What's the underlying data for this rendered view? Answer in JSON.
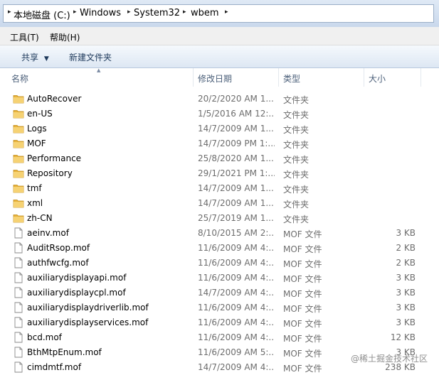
{
  "breadcrumb": [
    {
      "label": "本地磁盘 (C:)"
    },
    {
      "label": "Windows"
    },
    {
      "label": "System32"
    },
    {
      "label": "wbem"
    }
  ],
  "menu": {
    "tools": "工具(T)",
    "help": "帮助(H)"
  },
  "toolbar": {
    "share": "共享",
    "new_folder": "新建文件夹"
  },
  "columns": {
    "name": "名称",
    "date": "修改日期",
    "type": "类型",
    "size": "大小"
  },
  "files": [
    {
      "name": "AutoRecover",
      "date": "20/2/2020 AM 1...",
      "type": "文件夹",
      "size": "",
      "icon": "folder-icon"
    },
    {
      "name": "en-US",
      "date": "1/5/2016 AM 12:...",
      "type": "文件夹",
      "size": "",
      "icon": "folder-icon"
    },
    {
      "name": "Logs",
      "date": "14/7/2009 AM 1...",
      "type": "文件夹",
      "size": "",
      "icon": "folder-icon"
    },
    {
      "name": "MOF",
      "date": "14/7/2009 PM 1:...",
      "type": "文件夹",
      "size": "",
      "icon": "folder-icon"
    },
    {
      "name": "Performance",
      "date": "25/8/2020 AM 1...",
      "type": "文件夹",
      "size": "",
      "icon": "folder-icon"
    },
    {
      "name": "Repository",
      "date": "29/1/2021 PM 1:...",
      "type": "文件夹",
      "size": "",
      "icon": "folder-icon"
    },
    {
      "name": "tmf",
      "date": "14/7/2009 AM 1...",
      "type": "文件夹",
      "size": "",
      "icon": "folder-icon"
    },
    {
      "name": "xml",
      "date": "14/7/2009 AM 1...",
      "type": "文件夹",
      "size": "",
      "icon": "folder-icon"
    },
    {
      "name": "zh-CN",
      "date": "25/7/2019 AM 1...",
      "type": "文件夹",
      "size": "",
      "icon": "folder-icon"
    },
    {
      "name": "aeinv.mof",
      "date": "8/10/2015 AM 2:...",
      "type": "MOF 文件",
      "size": "3 KB",
      "icon": "file-icon"
    },
    {
      "name": "AuditRsop.mof",
      "date": "11/6/2009 AM 4:...",
      "type": "MOF 文件",
      "size": "2 KB",
      "icon": "file-icon"
    },
    {
      "name": "authfwcfg.mof",
      "date": "11/6/2009 AM 4:...",
      "type": "MOF 文件",
      "size": "2 KB",
      "icon": "file-icon"
    },
    {
      "name": "auxiliarydisplayapi.mof",
      "date": "11/6/2009 AM 4:...",
      "type": "MOF 文件",
      "size": "3 KB",
      "icon": "file-icon"
    },
    {
      "name": "auxiliarydisplaycpl.mof",
      "date": "14/7/2009 AM 4:...",
      "type": "MOF 文件",
      "size": "3 KB",
      "icon": "file-icon"
    },
    {
      "name": "auxiliarydisplaydriverlib.mof",
      "date": "11/6/2009 AM 4:...",
      "type": "MOF 文件",
      "size": "3 KB",
      "icon": "file-icon"
    },
    {
      "name": "auxiliarydisplayservices.mof",
      "date": "11/6/2009 AM 4:...",
      "type": "MOF 文件",
      "size": "3 KB",
      "icon": "file-icon"
    },
    {
      "name": "bcd.mof",
      "date": "11/6/2009 AM 4:...",
      "type": "MOF 文件",
      "size": "12 KB",
      "icon": "file-icon"
    },
    {
      "name": "BthMtpEnum.mof",
      "date": "11/6/2009 AM 5:...",
      "type": "MOF 文件",
      "size": "3 KB",
      "icon": "file-icon"
    },
    {
      "name": "cimdmtf.mof",
      "date": "14/7/2009 AM 4:...",
      "type": "MOF 文件",
      "size": "238 KB",
      "icon": "file-icon"
    }
  ],
  "watermark": "@稀土掘金技术社区"
}
